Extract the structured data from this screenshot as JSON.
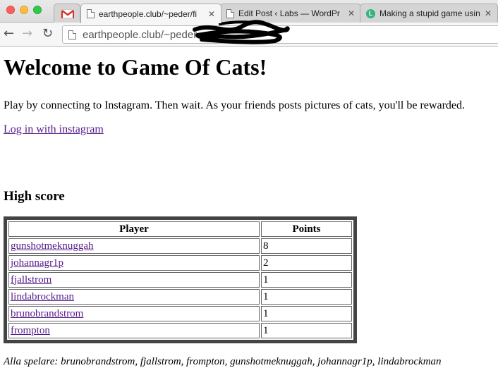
{
  "browser": {
    "tabs": [
      {
        "label": "",
        "icon": "gmail-icon"
      },
      {
        "label": "earthpeople.club/~peder/fi",
        "icon": "page-icon",
        "active": true
      },
      {
        "label": "Edit Post ‹ Labs — WordPr",
        "icon": "page-icon"
      },
      {
        "label": "Making a stupid game usin",
        "icon": "green-circle-icon",
        "icon_letter": "L"
      }
    ],
    "url": "earthpeople.club/~peder",
    "close_glyph": "✕"
  },
  "page": {
    "title": "Welcome to Game Of Cats!",
    "intro": "Play by connecting to Instagram. Then wait. As your friends posts pictures of cats, you'll be rewarded.",
    "login_link": "Log in with instagram",
    "highscore_heading": "High score",
    "table": {
      "headers": [
        "Player",
        "Points"
      ],
      "rows": [
        {
          "player": "gunshotmeknuggah",
          "points": "8"
        },
        {
          "player": "johannagr1p",
          "points": "2"
        },
        {
          "player": "fjallstrom",
          "points": "1"
        },
        {
          "player": "lindabrockman",
          "points": "1"
        },
        {
          "player": "brunobrandstrom",
          "points": "1"
        },
        {
          "player": "frompton",
          "points": "1"
        }
      ]
    },
    "all_players": "Alla spelare: brunobrandstrom, fjallstrom, frompton, gunshotmeknuggah, johannagr1p, lindabrockman"
  },
  "colors": {
    "visited_link": "#551a8b",
    "table_border": "#444444"
  }
}
